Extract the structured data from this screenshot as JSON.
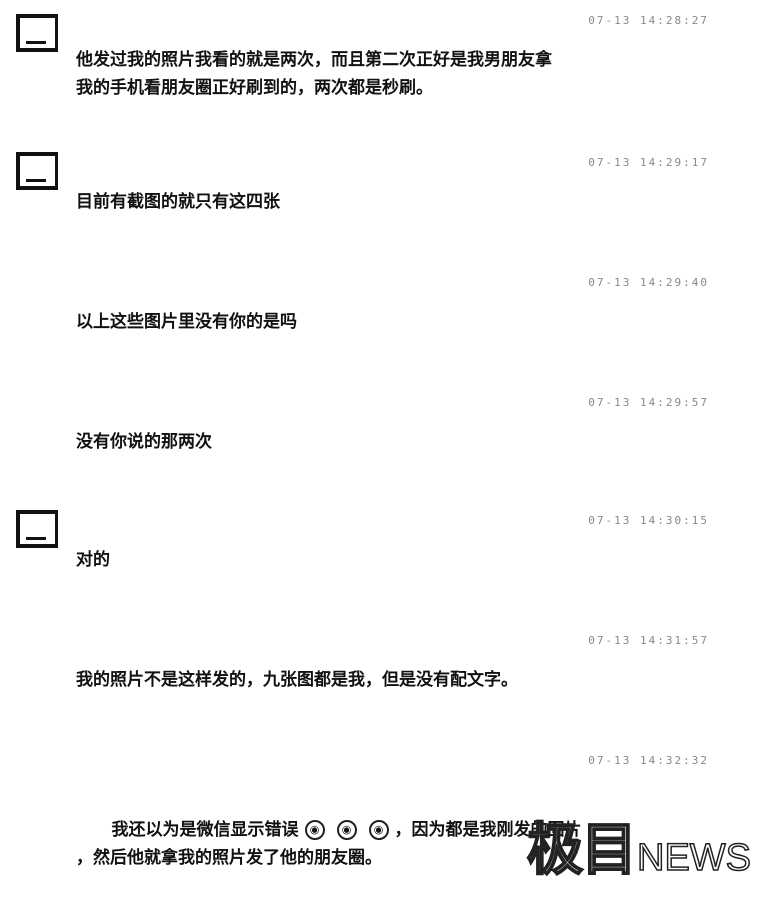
{
  "messages": [
    {
      "time": "07-13 14:28:27",
      "lines": "他发过我的照片我看的就是两次，而且第二次正好是我男朋友拿\n我的手机看朋友圈正好刷到的，两次都是秒刷。"
    },
    {
      "time": "07-13 14:29:17",
      "lines": "目前有截图的就只有这四张"
    },
    {
      "time": "07-13 14:29:40",
      "lines": "以上这些图片里没有你的是吗"
    },
    {
      "time": "07-13 14:29:57",
      "lines": "没有你说的那两次"
    },
    {
      "time": "07-13 14:30:15",
      "lines": "对的"
    },
    {
      "time": "07-13 14:31:57",
      "lines": "我的照片不是这样发的，九张图都是我，但是没有配文字。"
    },
    {
      "time": "07-13 14:32:32",
      "line1_before": "我还以为是微信显示错误",
      "emoji_glyph": "◉",
      "line1_after": "，因为都是我刚发的图片",
      "line2": "，然后他就拿我的照片发了他的朋友圈。"
    }
  ],
  "icons": {
    "avatar": "avatar-icon",
    "emoji": "laugh-cry-emoji-icon"
  },
  "watermark": {
    "cn": "极目",
    "en": "NEWS"
  }
}
